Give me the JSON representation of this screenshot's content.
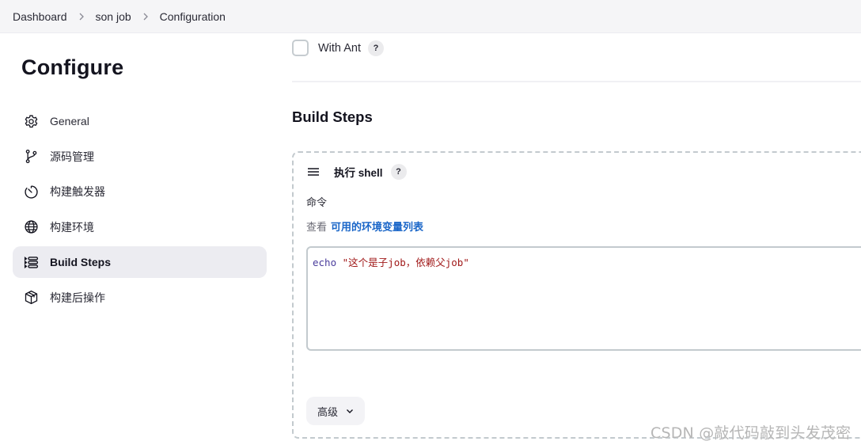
{
  "breadcrumb": {
    "items": [
      "Dashboard",
      "son job",
      "Configuration"
    ]
  },
  "sidebar": {
    "title": "Configure",
    "items": [
      {
        "label": "General",
        "icon": "gear-icon",
        "active": false
      },
      {
        "label": "源码管理",
        "icon": "branch-icon",
        "active": false
      },
      {
        "label": "构建触发器",
        "icon": "timer-icon",
        "active": false
      },
      {
        "label": "构建环境",
        "icon": "globe-icon",
        "active": false
      },
      {
        "label": "Build Steps",
        "icon": "list-steps-icon",
        "active": true
      },
      {
        "label": "构建后操作",
        "icon": "package-icon",
        "active": false
      }
    ]
  },
  "main": {
    "with_ant": {
      "label": "With Ant",
      "checked": false,
      "help": "?"
    },
    "section_title": "Build Steps",
    "step": {
      "title": "执行 shell",
      "help": "?",
      "command_label": "命令",
      "env_prefix": "查看",
      "env_link": "可用的环境变量列表",
      "command": {
        "keyword": "echo",
        "string": "\"这个是子job，依赖父job\""
      },
      "advanced_label": "高级"
    }
  },
  "watermark": "CSDN @敲代码敲到头发茂密"
}
